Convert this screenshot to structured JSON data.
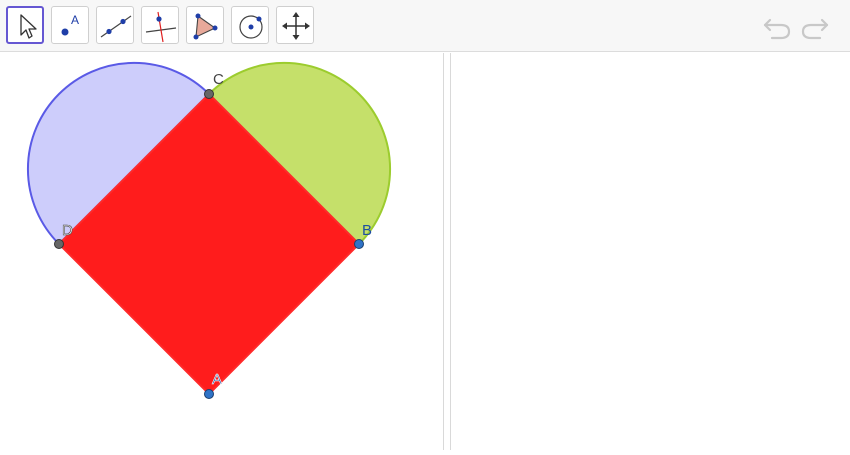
{
  "toolbar": {
    "tools": [
      {
        "name": "move",
        "icon": "move-arrow-icon",
        "active": true
      },
      {
        "name": "point",
        "icon": "point-icon",
        "label": "A"
      },
      {
        "name": "line",
        "icon": "line-through-two-points-icon"
      },
      {
        "name": "perpendicular-line",
        "icon": "perpendicular-line-icon"
      },
      {
        "name": "polygon",
        "icon": "polygon-icon"
      },
      {
        "name": "circle",
        "icon": "circle-with-center-icon"
      },
      {
        "name": "move-graphics-view",
        "icon": "move-graphics-view-icon"
      }
    ],
    "undo_icon": "undo-icon",
    "redo_icon": "redo-icon"
  },
  "construction": {
    "points": [
      "A",
      "B",
      "C",
      "D"
    ],
    "colors": {
      "square_fill": "#ff1c1c",
      "square_stroke": "#ff2a2a",
      "left_semicircle_fill": "#cdcdfb",
      "left_semicircle_stroke": "#5a5ae6",
      "right_semicircle_fill": "#c5e06a",
      "right_semicircle_stroke": "#9ccc2e",
      "point_blue": "#2f73c7",
      "point_gray": "#666666",
      "accent": "#6557d2"
    }
  }
}
